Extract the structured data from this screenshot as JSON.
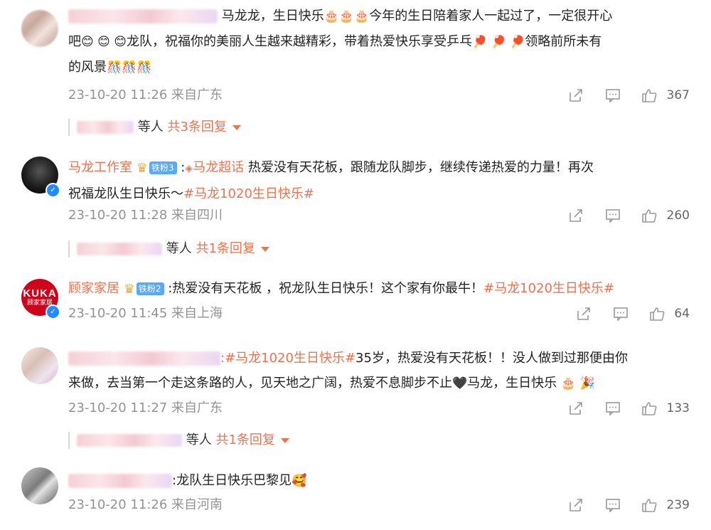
{
  "comments": [
    {
      "text_a": "马龙龙，生日快乐",
      "emoji_a": "🎂🎂🎂",
      "text_b": "今年的生日陪着家人一起过了，一定很开心",
      "text_c": "吧",
      "emoji_b": "😊 😊 😊",
      "text_d": "龙队，祝福你的美丽人生越来越精彩，带着热爱快乐享受乒乓",
      "emoji_c": "🏓 🏓 🏓",
      "text_e": "领略前所未有",
      "text_f": "的风景",
      "emoji_d": "🎊🎊🎊",
      "time": "23-10-20 11:26 来自广东",
      "likes": "367",
      "reply_suffix": "等人",
      "reply_more": "共3条回复"
    },
    {
      "author": "马龙工作室",
      "fan_badge": "铁粉3",
      "topic": "马龙超话",
      "text_a": "热爱没有天花板，跟随龙队脚步，继续传递热爱的力量！再次",
      "text_b": "祝福龙队生日快乐～",
      "hashtag": "#马龙1020生日快乐#",
      "time": "23-10-20 11:28 来自四川",
      "likes": "260",
      "reply_suffix": "等人",
      "reply_more": "共1条回复"
    },
    {
      "author": "顾家家居",
      "avatar_text_1": "KUKA",
      "avatar_text_2": "顾家家居",
      "fan_badge": "铁粉2",
      "text_a": ":热爱没有天花板 ，祝龙队生日快乐！这个家有你最牛！",
      "hashtag": "#马龙1020生日快乐#",
      "time": "23-10-20 11:45 来自上海",
      "likes": "64"
    },
    {
      "hashtag": ":#马龙1020生日快乐#",
      "text_a": "35岁，热爱没有天花板！！没人做到过那便由你",
      "text_b": "来做，去当第一个走这条路的人，见天地之广阔，热爱不息脚步不止",
      "emoji_a": "🖤",
      "text_c": "马龙，生日快乐",
      "emoji_b": "🎂 🎉",
      "time": "23-10-20 11:27 来自广东",
      "likes": "133",
      "reply_suffix": "等人",
      "reply_more": "共1条回复"
    },
    {
      "text_a": ":龙队生日快乐巴黎见",
      "emoji_a": "🥰",
      "time": "23-10-20 11:26 来自河南",
      "likes": "239"
    }
  ],
  "colors": {
    "accent": "#eb7350",
    "meta": "#939393",
    "verified": "#1f8cff"
  },
  "icons": [
    "share-icon",
    "comment-icon",
    "like-icon",
    "dropdown-caret-icon",
    "verified-icon",
    "crown-icon"
  ]
}
